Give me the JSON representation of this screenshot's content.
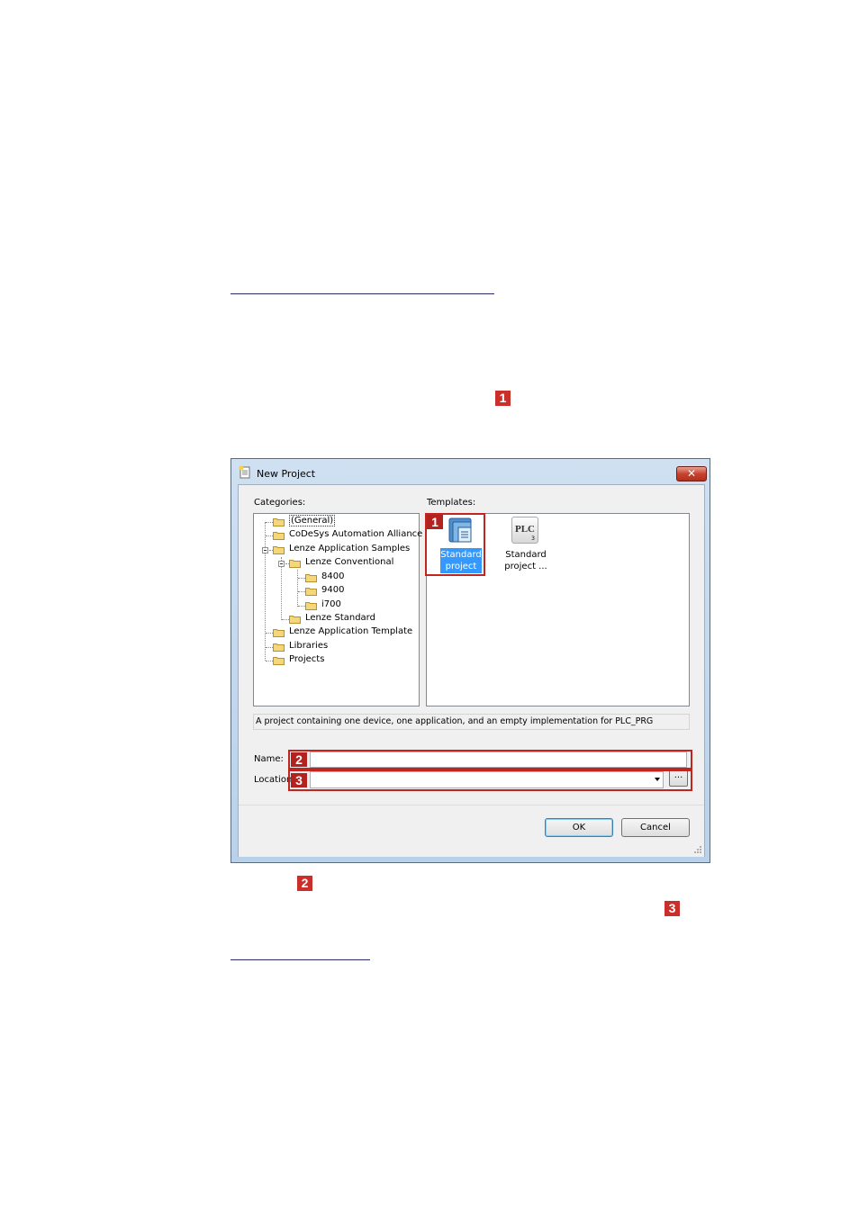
{
  "markers": {
    "intro": "1",
    "name": "2",
    "location": "3"
  },
  "dialog": {
    "title": "New Project",
    "close_label": "✕",
    "categories_label": "Categories:",
    "templates_label": "Templates:",
    "categories": [
      {
        "label": "(General)"
      },
      {
        "label": "CoDeSys Automation Alliance"
      },
      {
        "label": "Lenze Application Samples"
      },
      {
        "label": "Lenze Conventional"
      },
      {
        "label": "8400"
      },
      {
        "label": "9400"
      },
      {
        "label": "i700"
      },
      {
        "label": "Lenze Standard"
      },
      {
        "label": "Lenze Application Template"
      },
      {
        "label": "Libraries"
      },
      {
        "label": "Projects"
      }
    ],
    "templates": [
      {
        "label_line1": "Standard",
        "label_line2": "project",
        "selected": true
      },
      {
        "label_line1": "Standard",
        "label_line2": "project ...",
        "icon_text": "PLC",
        "icon_sub": "3",
        "selected": false
      }
    ],
    "description": "A project containing one device, one application, and an empty implementation for PLC_PRG",
    "name_label": "Name:",
    "name_value": "",
    "location_label": "Location",
    "location_value": "",
    "browse_label": "...",
    "ok_label": "OK",
    "cancel_label": "Cancel"
  },
  "colors": {
    "marker_red": "#c9302c",
    "selection_blue": "#3399ff"
  }
}
